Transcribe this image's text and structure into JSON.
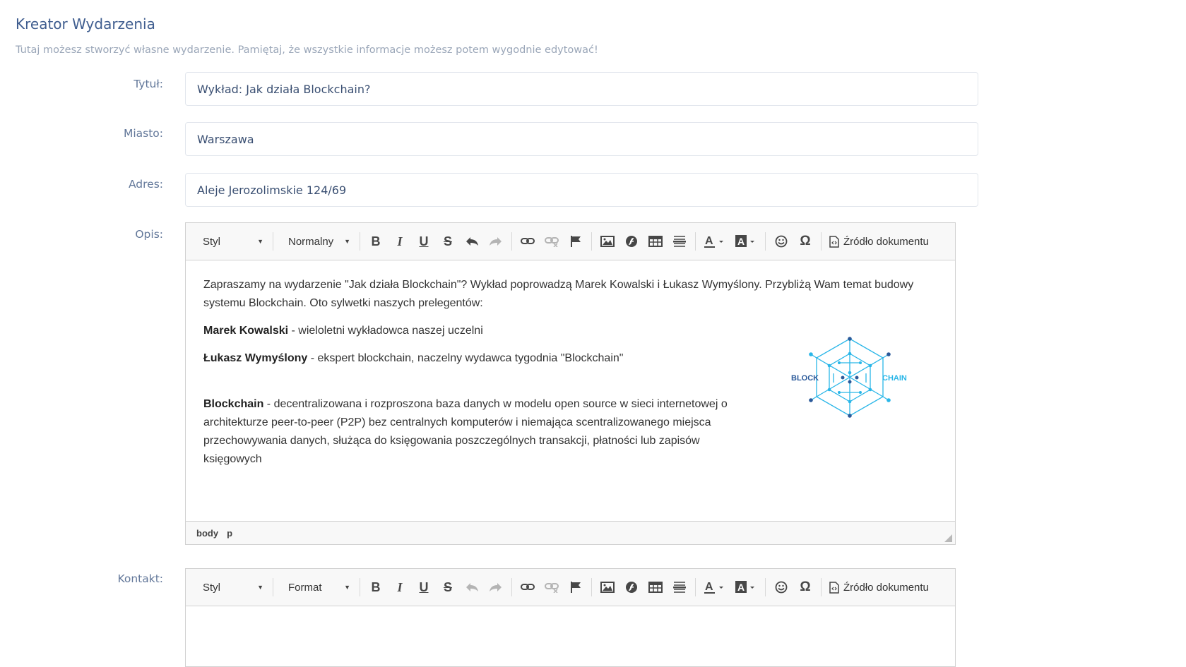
{
  "page": {
    "title": "Kreator Wydarzenia",
    "subtitle": "Tutaj możesz stworzyć własne wydarzenie. Pamiętaj, że wszystkie informacje możesz potem wygodnie edytować!"
  },
  "form": {
    "title": {
      "label": "Tytuł:",
      "value": "Wykład: Jak działa Blockchain?"
    },
    "city": {
      "label": "Miasto:",
      "value": "Warszawa"
    },
    "address": {
      "label": "Adres:",
      "value": "Aleje Jerozolimskie 124/69"
    },
    "description": {
      "label": "Opis:"
    },
    "contact": {
      "label": "Kontakt:"
    }
  },
  "editor_description": {
    "style_combo": "Styl",
    "format_combo": "Normalny",
    "source_button": "Źródło dokumentu",
    "paragraph_intro": "Zapraszamy na wydarzenie \"Jak działa Blockchain\"? Wykład poprowadzą Marek Kowalski i Łukasz Wymyślony. Przybliżą Wam temat budowy systemu Blockchain. Oto sylwetki naszych prelegentów:",
    "speaker1_name": "Marek Kowalski",
    "speaker1_desc": " - wieloletni wykładowca naszej uczelni",
    "speaker2_name": "Łukasz Wymyślony",
    "speaker2_desc": " - ekspert blockchain, naczelny wydawca tygodnia \"Blockchain\"",
    "def_term": "Blockchain",
    "def_text": " - decentralizowana i rozproszona baza danych w modelu open source w sieci internetowej o architekturze peer-to-peer (P2P) bez centralnych komputerów i niemająca scentralizowanego miejsca przechowywania danych, służąca do księgowania poszczególnych transakcji, płatności lub zapisów księgowych",
    "logo_left_text": "BLOCK",
    "logo_right_text": "CHAIN",
    "path_body": "body",
    "path_p": "p"
  },
  "editor_contact": {
    "style_combo": "Styl",
    "format_combo": "Format",
    "source_button": "Źródło dokumentu"
  },
  "colors": {
    "title": "#3f5d8f",
    "label": "#63789a",
    "logo_dark": "#2b5a9a",
    "logo_light": "#29b6e8"
  }
}
